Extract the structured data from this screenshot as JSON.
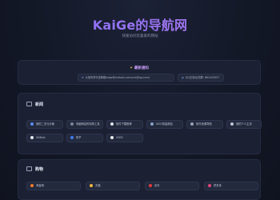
{
  "header": {
    "title": "KaiGe的导航网",
    "subtitle": "快速访问您喜爱的网站"
  },
  "notice": {
    "title": "最新通知",
    "email_text": "大家有事可发邮箱kaige@outlook.com(uvx@qq.com)",
    "qq_text": "QQ交流/反馈群: 862443957"
  },
  "sections": [
    {
      "title": "新闻",
      "links": [
        {
          "label": "我的二次元头像",
          "color": "#5b8def"
        },
        {
          "label": "电脑网站的机构工具",
          "color": "#7a8399"
        },
        {
          "label": "软件下载推荐",
          "color": "#e0e4ee"
        },
        {
          "label": "DOG的高频站",
          "color": "#8aa0c8"
        },
        {
          "label": "软件资源导航",
          "color": "#9aa3ba"
        },
        {
          "label": "我的个人主页",
          "color": "#c0c6d6"
        },
        {
          "label": "GitHub",
          "color": "#e6ebf5"
        },
        {
          "label": "知乎",
          "color": "#3f7df0"
        },
        {
          "label": "V2EX",
          "color": "#f0f0f0"
        }
      ]
    },
    {
      "title": "购物",
      "links": [
        {
          "label": "淘宝网",
          "color": "#f27b2a"
        },
        {
          "label": "天猫",
          "color": "#f0b43c"
        },
        {
          "label": "京东",
          "color": "#e23a3a"
        },
        {
          "label": "拼多多",
          "color": "#e0457a"
        }
      ]
    }
  ],
  "icons": {
    "notice": "sparkle-icon",
    "email": "mail-icon",
    "qq": "chat-icon",
    "news": "news-icon",
    "shop": "cart-icon"
  }
}
